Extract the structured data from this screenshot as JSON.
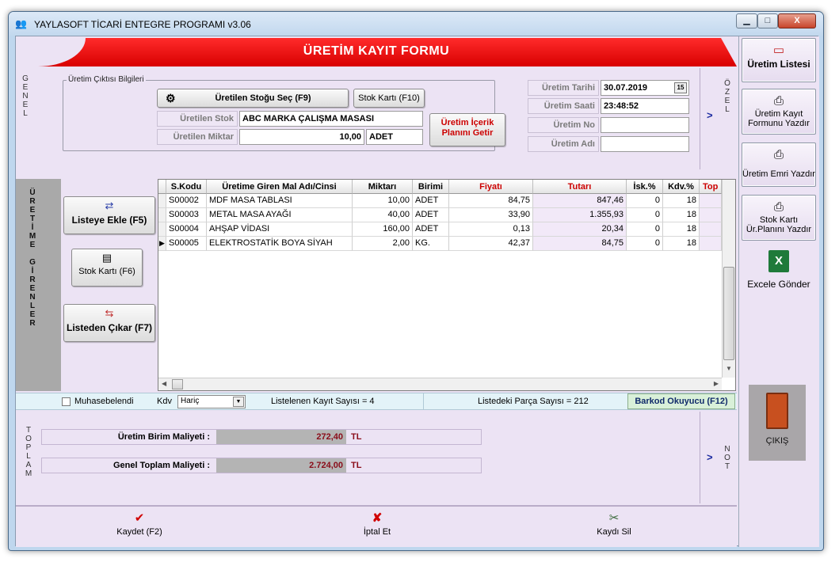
{
  "window": {
    "title": "YAYLASOFT TİCARİ ENTEGRE PROGRAMI v3.06",
    "min": "▁",
    "max": "□",
    "close": "X"
  },
  "form": {
    "title": "ÜRETİM KAYIT FORMU"
  },
  "genel": {
    "vertical_label": "G\nE\nN\nE\nL",
    "group_title": "Üretim Çıktısı Bilgileri",
    "select_stock_button": "Üretilen Stoğu Seç (F9)",
    "stock_card_button": "Stok Kartı (F10)",
    "produced_stock_label": "Üretilen Stok",
    "produced_stock_value": "ABC MARKA ÇALIŞMA MASASI",
    "produced_qty_label": "Üretilen Miktar",
    "produced_qty_value": "10,00",
    "produced_unit_value": "ADET",
    "get_plan_button": "Üretim İçerik Planını Getir",
    "date_label": "Üretim Tarihi",
    "date_value": "30.07.2019",
    "date_icon": "15",
    "time_label": "Üretim Saati",
    "time_value": "23:48:52",
    "no_label": "Üretim No",
    "no_value": "",
    "name_label": "Üretim Adı",
    "name_value": "",
    "ozel_label": "Ö\nZ\nE\nL",
    "arrow": ">"
  },
  "girenler": {
    "vertical_label": "Ü\nR\nE\nT\nİ\nM\nE\n\nG\nİ\nR\nE\nN\nL\nE\nR",
    "add_button": "Listeye Ekle (F5)",
    "stock_card_button": "Stok Kartı (F6)",
    "remove_button": "Listeden Çıkar (F7)"
  },
  "grid": {
    "columns": [
      "S.Kodu",
      "Üretime Giren Mal Adı/Cinsi",
      "Miktarı",
      "Birimi",
      "Fiyatı",
      "Tutarı",
      "İsk.%",
      "Kdv.%",
      "Top"
    ],
    "rows": [
      [
        "S00002",
        "MDF MASA TABLASI",
        "10,00",
        "ADET",
        "84,75",
        "847,46",
        "0",
        "18"
      ],
      [
        "S00003",
        "METAL MASA AYAĞI",
        "40,00",
        "ADET",
        "33,90",
        "1.355,93",
        "0",
        "18"
      ],
      [
        "S00004",
        "AHŞAP VİDASI",
        "160,00",
        "ADET",
        "0,13",
        "20,34",
        "0",
        "18"
      ],
      [
        "S00005",
        "ELEKTROSTATİK BOYA SİYAH",
        "2,00",
        "KG.",
        "42,37",
        "84,75",
        "0",
        "18"
      ]
    ],
    "row_pointer": "▶"
  },
  "status": {
    "accounted_label": "Muhasebelendi",
    "kdv_label": "Kdv",
    "kdv_value": "Hariç",
    "record_count": "Listelenen Kayıt Sayısı = 4",
    "part_count": "Listedeki Parça Sayısı = 212",
    "barcode_button": "Barkod Okuyucu (F12)"
  },
  "toplam": {
    "vertical_label": "T\nO\nP\nL\nA\nM",
    "unit_cost_label": "Üretim Birim Maliyeti :",
    "unit_cost_value": "272,40",
    "total_cost_label": "Genel Toplam Maliyeti :",
    "total_cost_value": "2.724,00",
    "currency": "TL",
    "not_label": "N\nO\nT",
    "arrow": ">"
  },
  "bottom": {
    "save": "Kaydet (F2)",
    "cancel": "İptal Et",
    "delete": "Kaydı Sil"
  },
  "side": {
    "list_button": "Üretim Listesi",
    "print_form_button": "Üretim Kayıt Formunu Yazdır",
    "print_order_button": "Üretim Emri Yazdır",
    "print_stock_card_button": "Stok Kartı Ür.Planını Yazdır",
    "excel_button": "Excele Gönder",
    "exit_button": "ÇIKIŞ"
  },
  "colors": {
    "banner": "#e00000",
    "form_bg": "#ece3f4",
    "total_value": "#8a0d1a",
    "accent_text": "#cc0000"
  }
}
